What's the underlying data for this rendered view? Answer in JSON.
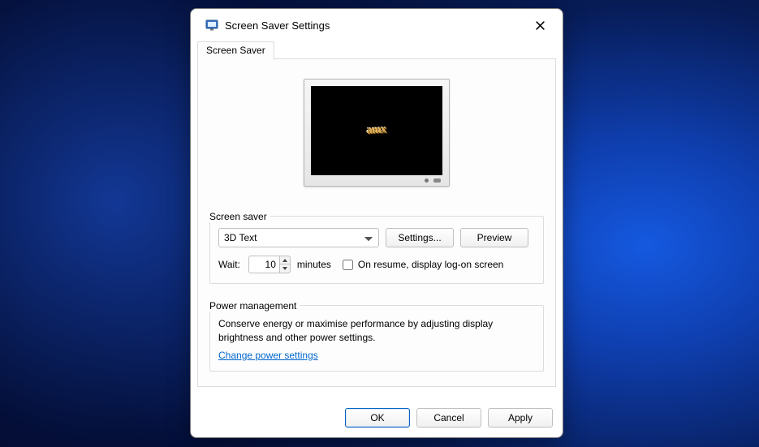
{
  "window": {
    "title": "Screen Saver Settings",
    "tab_label": "Screen Saver"
  },
  "preview": {
    "demo_text": "amx"
  },
  "screensaver_group": {
    "legend": "Screen saver",
    "selected": "3D Text",
    "settings_button": "Settings...",
    "preview_button": "Preview",
    "wait_label": "Wait:",
    "wait_value": "10",
    "minutes_label": "minutes",
    "onresume_label": "On resume, display log-on screen",
    "onresume_checked": false
  },
  "power_group": {
    "legend": "Power management",
    "text": "Conserve energy or maximise performance by adjusting display brightness and other power settings.",
    "link": "Change power settings"
  },
  "footer": {
    "ok": "OK",
    "cancel": "Cancel",
    "apply": "Apply"
  }
}
